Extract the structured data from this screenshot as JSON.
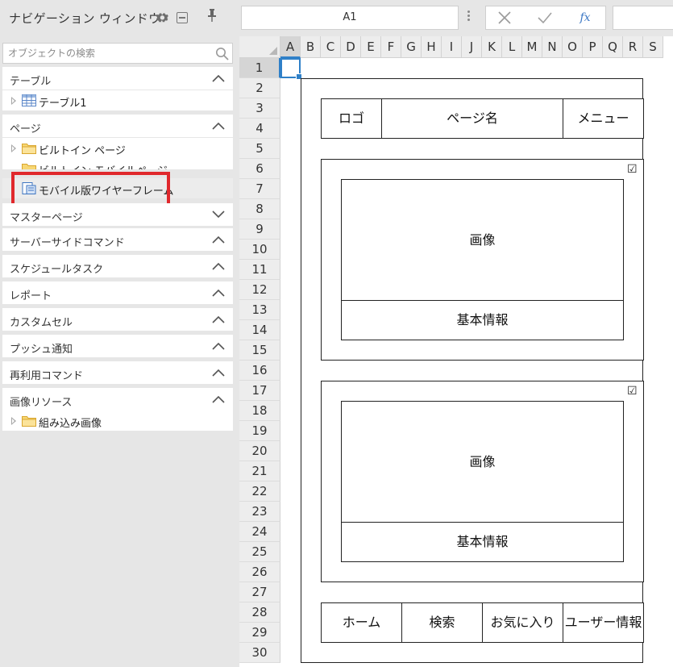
{
  "nav": {
    "title": "ナビゲーション ウィンドウ",
    "search_placeholder": "オブジェクトの検索",
    "sections": {
      "table": {
        "label": "テーブル",
        "items": [
          "テーブル1"
        ]
      },
      "page": {
        "label": "ページ",
        "items": [
          "ビルトイン ページ",
          "ビルトイン モバイルページ",
          "モバイル版ワイヤーフレーム"
        ]
      },
      "master": {
        "label": "マスターページ"
      },
      "server_command": {
        "label": "サーバーサイドコマンド"
      },
      "scheduled_task": {
        "label": "スケジュールタスク"
      },
      "report": {
        "label": "レポート"
      },
      "custom_cell": {
        "label": "カスタムセル"
      },
      "push": {
        "label": "プッシュ通知"
      },
      "reuse_command": {
        "label": "再利用コマンド"
      },
      "image_resource": {
        "label": "画像リソース",
        "items": [
          "組み込み画像"
        ]
      }
    },
    "highlight_color": "#e0282c"
  },
  "formula_bar": {
    "name_box": "A1",
    "cancel_icon": "close-icon",
    "confirm_icon": "check-icon",
    "fx_label": "fx"
  },
  "sheet": {
    "columns": [
      "A",
      "B",
      "C",
      "D",
      "E",
      "F",
      "G",
      "H",
      "I",
      "J",
      "K",
      "L",
      "M",
      "N",
      "O",
      "P",
      "Q",
      "R",
      "S"
    ],
    "rows": [
      "1",
      "2",
      "3",
      "4",
      "5",
      "6",
      "7",
      "8",
      "9",
      "10",
      "11",
      "12",
      "13",
      "14",
      "15",
      "16",
      "17",
      "18",
      "19",
      "20",
      "21",
      "22",
      "23",
      "24",
      "25",
      "26",
      "27",
      "28",
      "29",
      "30"
    ],
    "selection_color": "#2f80c8"
  },
  "wireframe": {
    "header": {
      "logo": "ロゴ",
      "page_name": "ページ名",
      "menu": "メニュー"
    },
    "cards": [
      {
        "checkbox": "☑",
        "image": "画像",
        "info": "基本情報"
      },
      {
        "checkbox": "☑",
        "image": "画像",
        "info": "基本情報"
      }
    ],
    "footer": {
      "home": "ホーム",
      "search": "検索",
      "favorites": "お気に入り",
      "user_info": "ユーザー情報"
    }
  }
}
